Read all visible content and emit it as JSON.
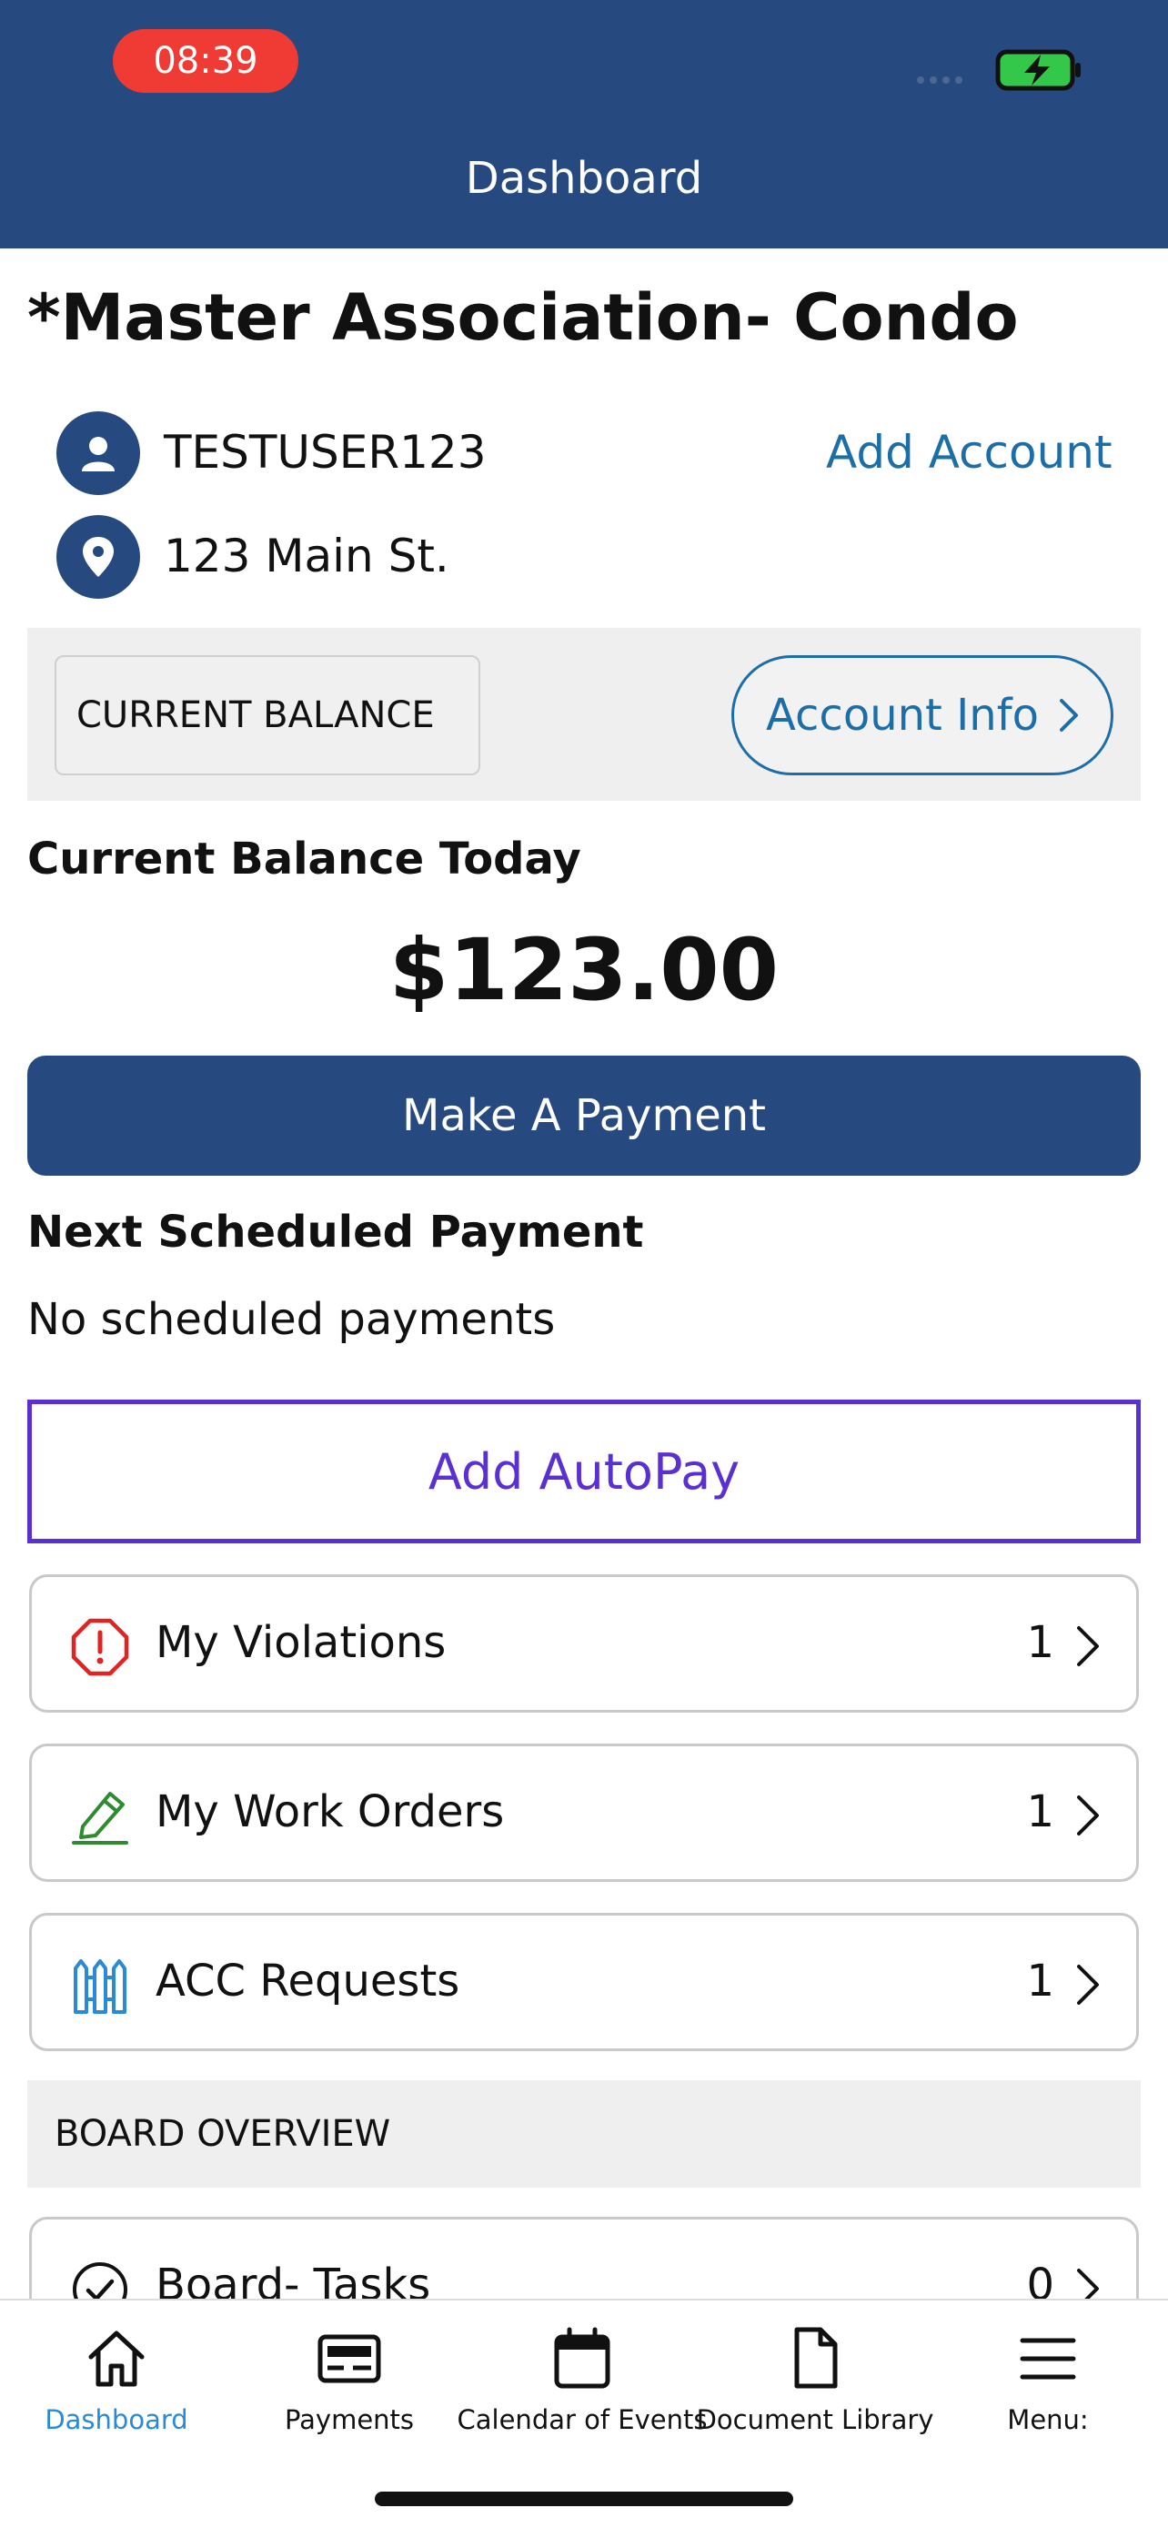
{
  "status_bar": {
    "time": "08:39"
  },
  "header": {
    "title": "Dashboard"
  },
  "association": {
    "name": "*Master Association- Condo"
  },
  "account": {
    "username": "TESTUSER123",
    "address": "123 Main St.",
    "add_account_label": "Add Account"
  },
  "balance_band": {
    "current_balance_label": "CURRENT BALANCE",
    "account_info_label": "Account Info"
  },
  "balance": {
    "heading": "Current Balance Today",
    "amount": "$123.00",
    "pay_button_label": "Make A Payment"
  },
  "schedule": {
    "heading": "Next Scheduled Payment",
    "status": "No scheduled payments"
  },
  "autopay": {
    "label": "Add AutoPay"
  },
  "list_items": [
    {
      "label": "My Violations",
      "count": "1",
      "icon": "alert-octagon-icon",
      "color": "#e02424"
    },
    {
      "label": "My Work Orders",
      "count": "1",
      "icon": "pencil-edit-icon",
      "color": "#2e8b2e"
    },
    {
      "label": "ACC Requests",
      "count": "1",
      "icon": "fence-icon",
      "color": "#2b8ad8"
    }
  ],
  "board": {
    "section_label": "BOARD OVERVIEW",
    "tasks": {
      "label": "Board- Tasks",
      "count": "0",
      "icon": "check-circle-icon"
    }
  },
  "tabbar": [
    {
      "label": "Dashboard",
      "icon": "home-icon",
      "active": true
    },
    {
      "label": "Payments",
      "icon": "payment-card-icon",
      "active": false
    },
    {
      "label": "Calendar of Events",
      "icon": "calendar-icon",
      "active": false
    },
    {
      "label": "Document Library",
      "icon": "document-icon",
      "active": false
    },
    {
      "label": "Menu:",
      "icon": "menu-icon",
      "active": false
    }
  ],
  "colors": {
    "brand_navy": "#264a7f",
    "link_blue": "#1c6ea8",
    "autopay_purple": "#5b30d3",
    "active_tab": "#2b8ad8"
  }
}
